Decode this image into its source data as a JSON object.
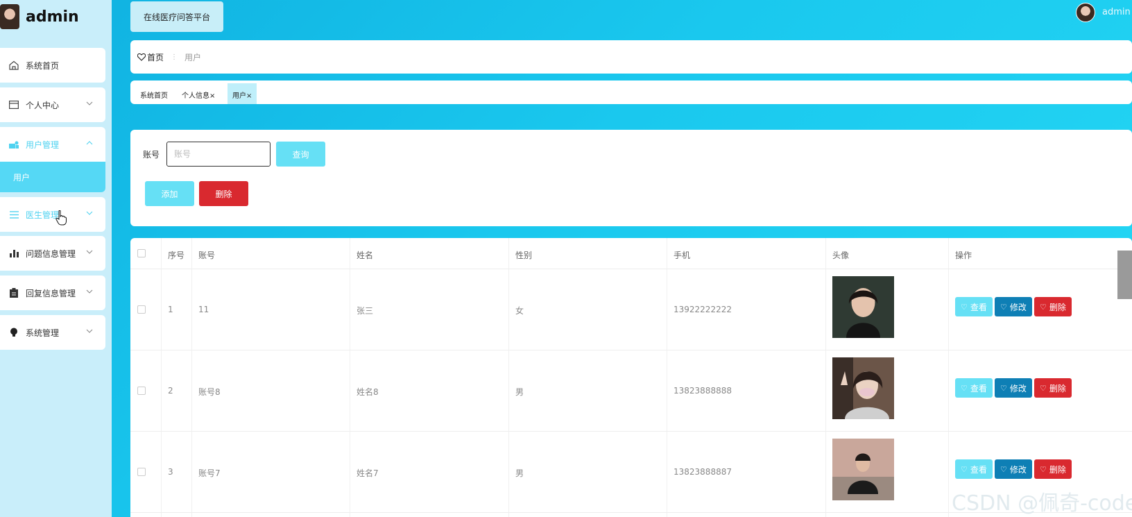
{
  "brand": {
    "title": "admin"
  },
  "sidebar": {
    "items": [
      {
        "label": "系统首页",
        "icon": "home-icon"
      },
      {
        "label": "个人中心",
        "icon": "wallet-icon"
      },
      {
        "label": "用户管理",
        "icon": "user-group-icon",
        "sub": [
          "用户"
        ]
      },
      {
        "label": "医生管理",
        "icon": "list-icon"
      },
      {
        "label": "问题信息管理",
        "icon": "bar-chart-icon"
      },
      {
        "label": "回复信息管理",
        "icon": "clipboard-icon"
      },
      {
        "label": "系统管理",
        "icon": "bulb-icon"
      }
    ]
  },
  "header": {
    "platform": "在线医疗问答平台",
    "user": "admin"
  },
  "breadcrumb": {
    "home": "首页",
    "current": "用户"
  },
  "tags": [
    {
      "label": "系统首页"
    },
    {
      "label": "个人信息",
      "close": "×"
    },
    {
      "label": "用户",
      "close": "×"
    }
  ],
  "search": {
    "label": "账号",
    "placeholder": "账号",
    "query_label": "查询",
    "add_label": "添加",
    "delete_label": "删除"
  },
  "table": {
    "headers": [
      "序号",
      "账号",
      "姓名",
      "性别",
      "手机",
      "头像",
      "操作"
    ],
    "rows": [
      {
        "index": "1",
        "account": "11",
        "name": "张三",
        "gender": "女",
        "phone": "13922222222"
      },
      {
        "index": "2",
        "account": "账号8",
        "name": "姓名8",
        "gender": "男",
        "phone": "13823888888"
      },
      {
        "index": "3",
        "account": "账号7",
        "name": "姓名7",
        "gender": "男",
        "phone": "13823888887"
      }
    ],
    "actions": {
      "view": "查看",
      "edit": "修改",
      "delete": "删除"
    }
  },
  "watermark": "CSDN @佩奇-code",
  "colors": {
    "accent": "#4fd2f0",
    "edit": "#0e7fb5",
    "danger": "#d9292f",
    "sidebar": "#c9eefa"
  }
}
